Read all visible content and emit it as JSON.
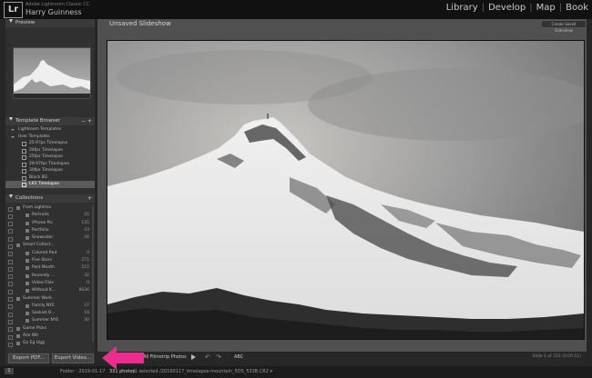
{
  "app": {
    "logo": "Lr",
    "name": "Adobe Lightroom Classic CC",
    "user": "Harry Guinness"
  },
  "modules": [
    "Library",
    "Develop",
    "Map",
    "Book"
  ],
  "left_panel": {
    "preview_header": "Preview",
    "template_browser_header": "Template Browser",
    "template_items": [
      {
        "label": "Lightroom Templates",
        "level": 1,
        "selected": false
      },
      {
        "label": "User Templates",
        "level": 1,
        "selected": false
      },
      {
        "label": "25 R?ps Timelapse",
        "level": 2,
        "selected": false
      },
      {
        "label": "24fps Timelapse",
        "level": 2,
        "selected": false
      },
      {
        "label": "25fps Timelapse",
        "level": 2,
        "selected": false
      },
      {
        "label": "29.97fps Timelapse",
        "level": 2,
        "selected": false
      },
      {
        "label": "30fps Timelapse",
        "level": 2,
        "selected": false
      },
      {
        "label": "Black BG",
        "level": 2,
        "selected": false
      },
      {
        "label": "LR5 Timelapse",
        "level": 2,
        "selected": true
      }
    ],
    "collections_header": "Collections",
    "collection_items": [
      {
        "label": "From Lightroo",
        "count": "",
        "level": 1
      },
      {
        "label": "Portraits",
        "count": "25",
        "level": 2
      },
      {
        "label": "iPhone Pic",
        "count": "135",
        "level": 2
      },
      {
        "label": "Portfolio",
        "count": "43",
        "level": 2
      },
      {
        "label": "Snowsider",
        "count": "26",
        "level": 2
      },
      {
        "label": "Smart Collect...",
        "count": "",
        "level": 1
      },
      {
        "label": "Colored Red",
        "count": "0",
        "level": 2
      },
      {
        "label": "Five Stars",
        "count": "271",
        "level": 2
      },
      {
        "label": "Past Month",
        "count": "515",
        "level": 2
      },
      {
        "label": "Recently ...",
        "count": "32",
        "level": 2
      },
      {
        "label": "Video Files",
        "count": "0",
        "level": 2
      },
      {
        "label": "Without K...",
        "count": "8026",
        "level": 2
      },
      {
        "label": "Summer Work",
        "count": "",
        "level": 1
      },
      {
        "label": "Family NYE",
        "count": "27",
        "level": 2
      },
      {
        "label": "Saskiat O...",
        "count": "18",
        "level": 2
      },
      {
        "label": "Summer NYE",
        "count": "30",
        "level": 2
      },
      {
        "label": "Game Picks",
        "count": "",
        "level": 1
      },
      {
        "label": "Aile Wit",
        "count": "",
        "level": 1
      },
      {
        "label": "Go Eg Ugg",
        "count": "",
        "level": 1
      }
    ]
  },
  "export": {
    "pdf_label": "Export PDF...",
    "video_label": "Export Video..."
  },
  "center": {
    "title": "Unsaved Slideshow",
    "save_button": "Create Saved Slideshow",
    "toolbar_use": "All Filmstrip Photos",
    "toolbar_abc": "ABC",
    "slide_info": "Slide 1 of 331 (0:00:11)"
  },
  "filmstrip": {
    "page_num": "1",
    "folder": "Folder : 2019-01-17",
    "photos_count": "331 photos",
    "path": "/1 selected /20190117_timelapse-mountain_5DS_533B.CR2 ▾"
  },
  "colors": {
    "highlight_arrow": "#ec2d8e",
    "selected_row": "#5a5a5a",
    "background": "#262626"
  }
}
